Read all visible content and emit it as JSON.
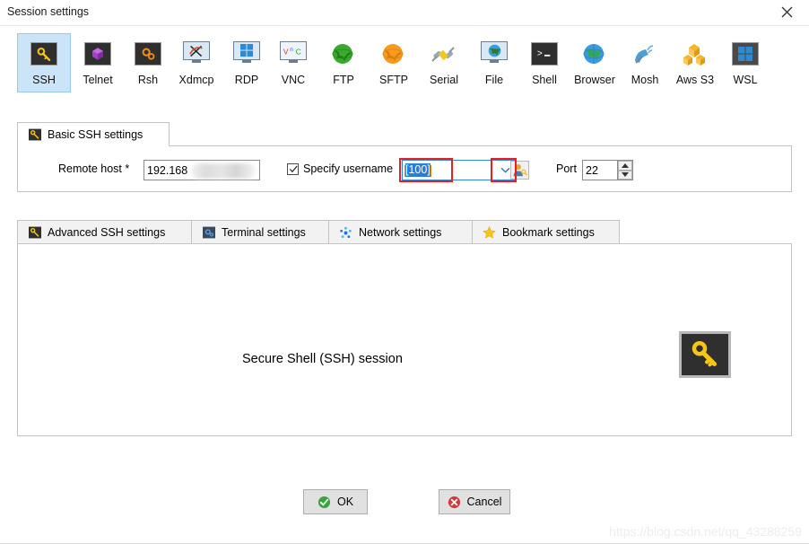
{
  "window": {
    "title": "Session settings",
    "close_label": "Close",
    "close_icon": "close-icon"
  },
  "session_types": [
    {
      "label": "SSH",
      "icon": "ssh-key-icon",
      "selected": true
    },
    {
      "label": "Telnet",
      "icon": "telnet-icon",
      "selected": false
    },
    {
      "label": "Rsh",
      "icon": "rsh-gears-icon",
      "selected": false
    },
    {
      "label": "Xdmcp",
      "icon": "xdmcp-icon",
      "selected": false
    },
    {
      "label": "RDP",
      "icon": "rdp-windows-icon",
      "selected": false
    },
    {
      "label": "VNC",
      "icon": "vnc-icon",
      "selected": false
    },
    {
      "label": "FTP",
      "icon": "ftp-globe-icon",
      "selected": false
    },
    {
      "label": "SFTP",
      "icon": "sftp-globe-icon",
      "selected": false
    },
    {
      "label": "Serial",
      "icon": "serial-plug-icon",
      "selected": false
    },
    {
      "label": "File",
      "icon": "file-share-icon",
      "selected": false
    },
    {
      "label": "Shell",
      "icon": "shell-prompt-icon",
      "selected": false
    },
    {
      "label": "Browser",
      "icon": "browser-globe-icon",
      "selected": false
    },
    {
      "label": "Mosh",
      "icon": "mosh-dish-icon",
      "selected": false
    },
    {
      "label": "Aws S3",
      "icon": "aws-s3-icon",
      "selected": false
    },
    {
      "label": "WSL",
      "icon": "wsl-windows-icon",
      "selected": false
    }
  ],
  "basic_panel": {
    "tab_label": "Basic SSH settings",
    "tab_icon": "ssh-key-icon",
    "remote_host": {
      "label": "Remote host *",
      "value": "192.168",
      "redacted": true
    },
    "specify_username": {
      "label": "Specify username",
      "checked": true,
      "value": "[100]",
      "selected": true,
      "dropdown_icon": "chevron-down-icon",
      "browse_icon": "user-key-icon"
    },
    "port": {
      "label": "Port",
      "value": "22",
      "up_icon": "spinner-up-icon",
      "down_icon": "spinner-down-icon"
    }
  },
  "settings_tabs": [
    {
      "label": "Advanced SSH settings",
      "icon": "ssh-key-icon",
      "active": false
    },
    {
      "label": "Terminal settings",
      "icon": "terminal-icon",
      "active": false
    },
    {
      "label": "Network settings",
      "icon": "network-icon",
      "active": false
    },
    {
      "label": "Bookmark settings",
      "icon": "star-icon",
      "active": false
    }
  ],
  "content": {
    "headline": "Secure Shell (SSH) session",
    "illustration_icon": "ssh-key-icon"
  },
  "footer": {
    "ok_label": "OK",
    "ok_icon": "check-circle-icon",
    "cancel_label": "Cancel",
    "cancel_icon": "cancel-circle-icon"
  },
  "watermark": "https://blog.csdn.net/qq_43288259",
  "colors": {
    "selection_blue": "#2a7fd4",
    "selected_tile": "#cce4f7",
    "annotation_red": "#ef1c1c",
    "key_yellow": "#f5c518",
    "ok_green": "#3aa33a",
    "cancel_red": "#d93636"
  }
}
